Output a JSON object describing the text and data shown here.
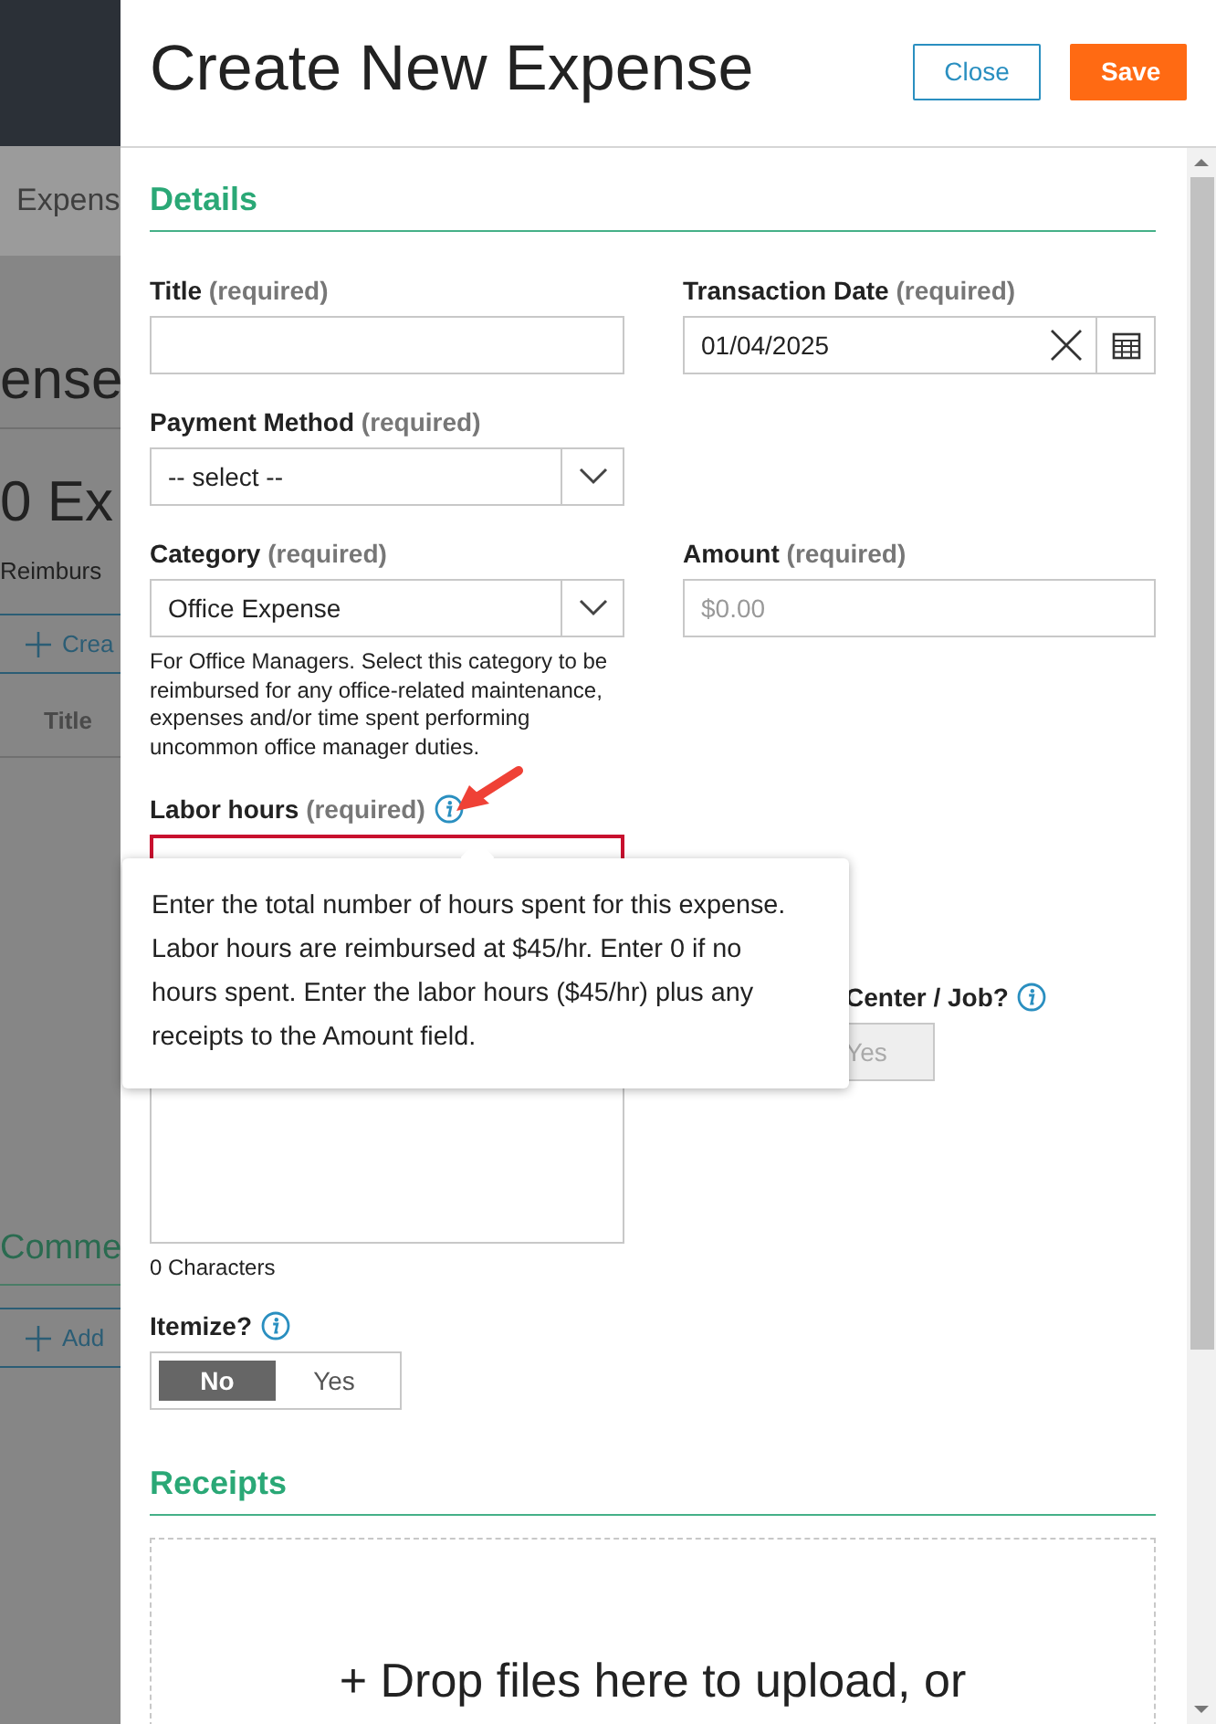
{
  "background_page": {
    "tab": "Expens",
    "heading": "ense",
    "count": "0 Ex",
    "subtitle": "Reimburs",
    "create_button": "Crea",
    "column": "Title",
    "comments_heading": "Comme",
    "add_button": "Add"
  },
  "drawer": {
    "title": "Create New Expense",
    "buttons": [
      {
        "label": "Close",
        "kind": "secondary"
      },
      {
        "label": "Save",
        "kind": "primary"
      }
    ]
  },
  "details": {
    "heading": "Details",
    "title_field": {
      "label": "Title",
      "note": "(required)"
    },
    "transaction_date": {
      "label": "Transaction Date",
      "note": "(required)",
      "value": "01/04/2025"
    },
    "payment_method": {
      "label": "Payment Method",
      "note": "(required)",
      "value": "-- select --"
    },
    "category": {
      "label": "Category",
      "note": "(required)",
      "value": "Office Expense",
      "help": "For Office Managers. Select this category to be reimbursed for any office-related maintenance, expenses and/or time spent performing uncommon office manager duties."
    },
    "amount": {
      "label": "Amount",
      "note": "(required)",
      "placeholder": "$0.00"
    },
    "labor_hours": {
      "label": "Labor hours",
      "note": "(required)",
      "invalid": true
    },
    "description": {
      "counter": "0 Characters"
    },
    "job": {
      "label": "Center / Job?",
      "disabled": true,
      "options": [
        {
          "label": "Yes",
          "selected": false
        }
      ]
    },
    "itemize": {
      "label": "Itemize?",
      "disabled": false,
      "options": [
        {
          "label": "No",
          "selected": true
        },
        {
          "label": "Yes",
          "selected": false
        }
      ]
    }
  },
  "tooltip": {
    "text": "Enter the total number of hours spent for this expense. Labor hours are reimbursed at $45/hr. Enter 0 if no hours spent. Enter the labor hours ($45/hr) plus any receipts to the Amount field."
  },
  "receipts": {
    "heading": "Receipts",
    "dropzone": "+ Drop files here to upload, or"
  }
}
